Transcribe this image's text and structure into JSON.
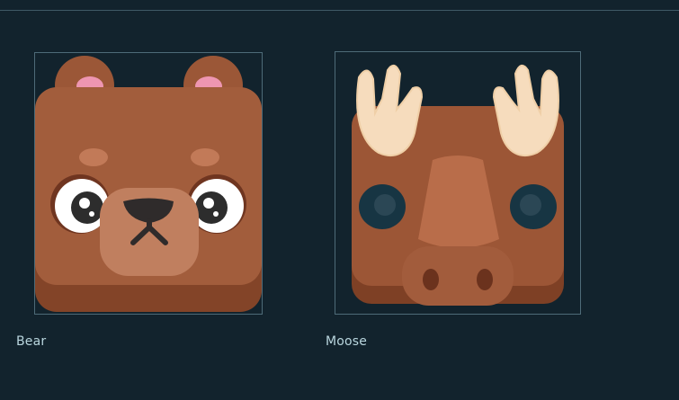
{
  "asset_grid": {
    "items": [
      {
        "label": "Bear",
        "icon": "bear-icon"
      },
      {
        "label": "Moose",
        "icon": "moose-icon"
      }
    ]
  },
  "colors": {
    "background": "#12232d",
    "tile_border": "#4e6b78",
    "label_text": "#b9d6de"
  }
}
